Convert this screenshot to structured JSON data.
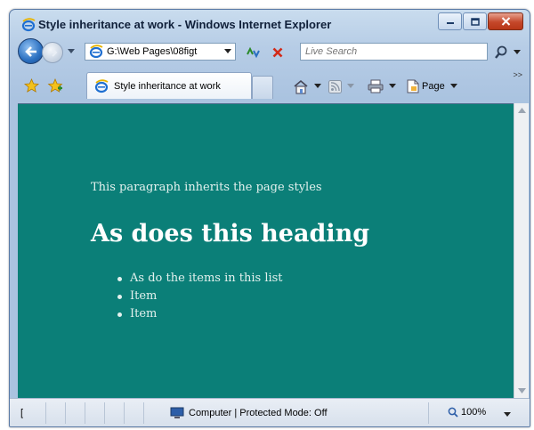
{
  "window": {
    "title": "Style inheritance at work - Windows Internet Explorer"
  },
  "address_bar": {
    "value": "G:\\Web Pages\\08figt"
  },
  "search": {
    "placeholder": "Live Search"
  },
  "tabs": [
    {
      "label": "Style inheritance at work"
    }
  ],
  "command_bar": {
    "page_label": "Page"
  },
  "content": {
    "paragraph": "This paragraph inherits the page styles",
    "heading": "As does this heading",
    "list_items": [
      "As do the items in this list",
      "Item",
      "Item"
    ],
    "background_color": "#0b7f78",
    "text_color": "#e3f1ee"
  },
  "status_bar": {
    "left_text": "[",
    "zone_text": "Computer | Protected Mode: Off",
    "zoom": "100%"
  }
}
